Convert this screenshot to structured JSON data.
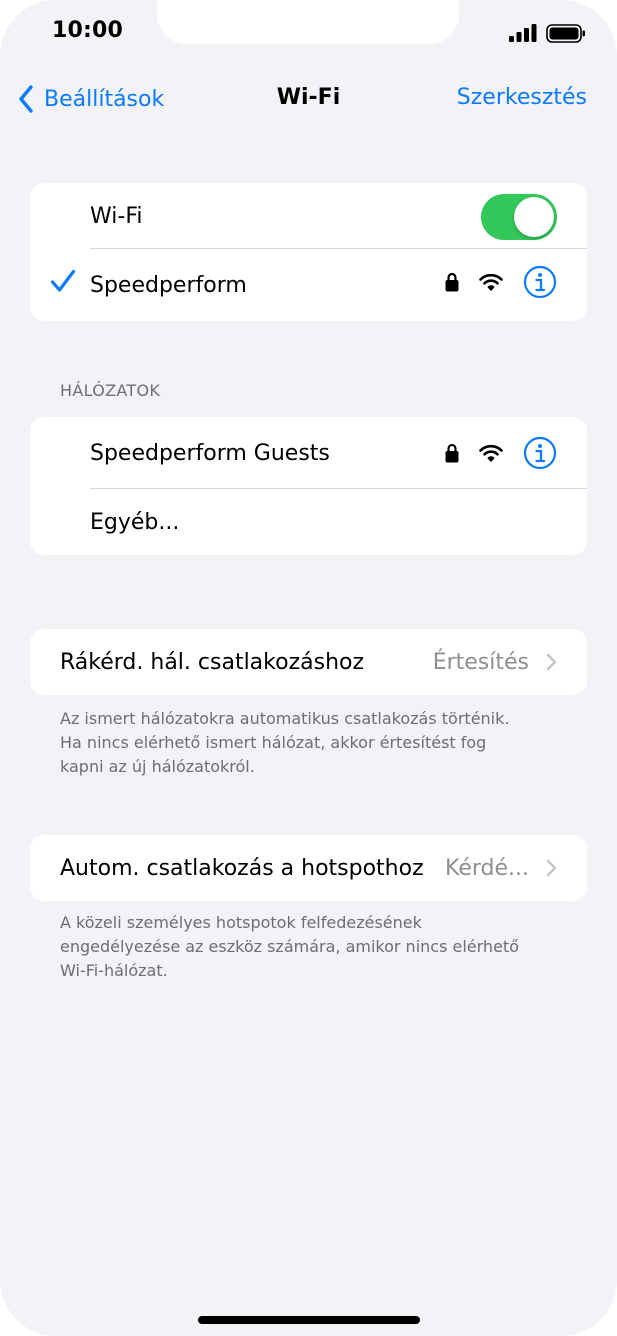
{
  "status": {
    "time": "10:00"
  },
  "nav": {
    "back_label": "Beállítások",
    "title": "Wi-Fi",
    "edit_label": "Szerkesztés"
  },
  "wifi_group": {
    "toggle_label": "Wi-Fi",
    "toggle_on": true,
    "connected_network": "Speedperform"
  },
  "networks": {
    "header": "HÁLÓZATOK",
    "items": [
      {
        "name": "Speedperform Guests"
      },
      {
        "name": "Egyéb..."
      }
    ]
  },
  "ask_join": {
    "label": "Rákérd. hál. csatlakozáshoz",
    "value": "Értesítés",
    "footer": "Az ismert hálózatokra automatikus csatlakozás történik. Ha nincs elérhető ismert hálózat, akkor értesítést fog kapni az új hálózatokról."
  },
  "auto_hotspot": {
    "label": "Autom. csatlakozás a hotspothoz",
    "value": "Kérdé...",
    "footer": "A közeli személyes hotspotok felfedezésének engedélyezése az eszköz számára, amikor nincs elérhető Wi-Fi-hálózat."
  },
  "colors": {
    "accent": "#0a7aff",
    "toggle_on": "#34c759",
    "background": "#f2f2f7",
    "secondary_text": "#6d6d72"
  },
  "icons": [
    "cellular-signal-icon",
    "battery-icon",
    "chevron-left-icon",
    "checkmark-icon",
    "lock-icon",
    "wifi-icon",
    "info-icon",
    "chevron-right-icon"
  ]
}
